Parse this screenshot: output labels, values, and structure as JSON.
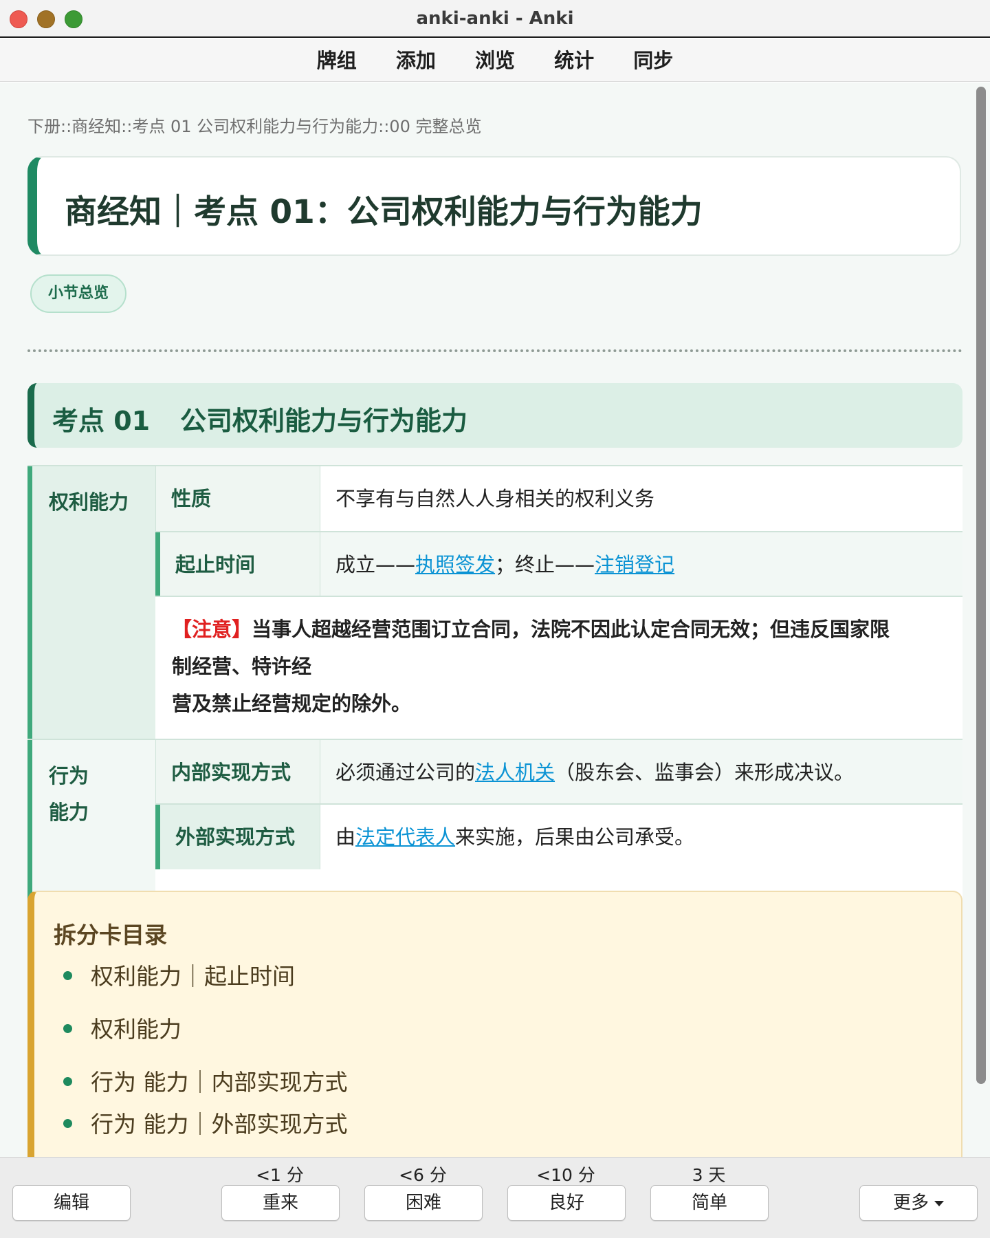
{
  "window": {
    "title": "anki-anki - Anki"
  },
  "menu": {
    "items": [
      "牌组",
      "添加",
      "浏览",
      "统计",
      "同步"
    ]
  },
  "card": {
    "breadcrumb": "下册::商经知::考点 01 公司权利能力与行为能力::00 完整总览",
    "hero_title": "商经知｜考点 01：公司权利能力与行为能力",
    "pill": "小节总览",
    "section": {
      "number": "考点 01",
      "name": "公司权利能力与行为能力"
    },
    "table": {
      "rows": {
        "cat1": "权利能力",
        "cat2_line1": "行为",
        "cat2_line2": "能力",
        "r1_sub": "性质",
        "r1_val": "不享有与自然人人身相关的权利义务",
        "r2_sub": "起止时间",
        "r2_pre": "成立——",
        "r2_link1": "执照签发",
        "r2_mid": "；终止——",
        "r2_link2": "注销登记",
        "note_tag": "【注意】",
        "note_line1": "当事人超越经营范围订立合同，法院不因此认定合同无效；但违反国家限",
        "note_line2": "制经营、特许经",
        "note_line3": "营及禁止经营规定的除外。",
        "r4_sub": "内部实现方式",
        "r4_pre": "必须通过公司的",
        "r4_link": "法人机关",
        "r4_post": "（股东会、监事会）来形成决议。",
        "r5_sub": "外部实现方式",
        "r5_pre": "由",
        "r5_link": "法定代表人",
        "r5_post": "来实施，后果由公司承受。"
      }
    },
    "split": {
      "title": "拆分卡目录",
      "items": [
        "权利能力｜起止时间",
        "权利能力",
        "行为 能力｜内部实现方式",
        "行为 能力｜外部实现方式"
      ]
    }
  },
  "bottom": {
    "edit": "编辑",
    "more": "更多",
    "answers": [
      {
        "interval": "<1 分",
        "label": "重来"
      },
      {
        "interval": "<6 分",
        "label": "困难"
      },
      {
        "interval": "<10 分",
        "label": "良好"
      },
      {
        "interval": "3 天",
        "label": "简单"
      }
    ]
  },
  "colors": {
    "accent": "#1f8a63",
    "link": "#0b93d4",
    "warning": "#e02020"
  }
}
